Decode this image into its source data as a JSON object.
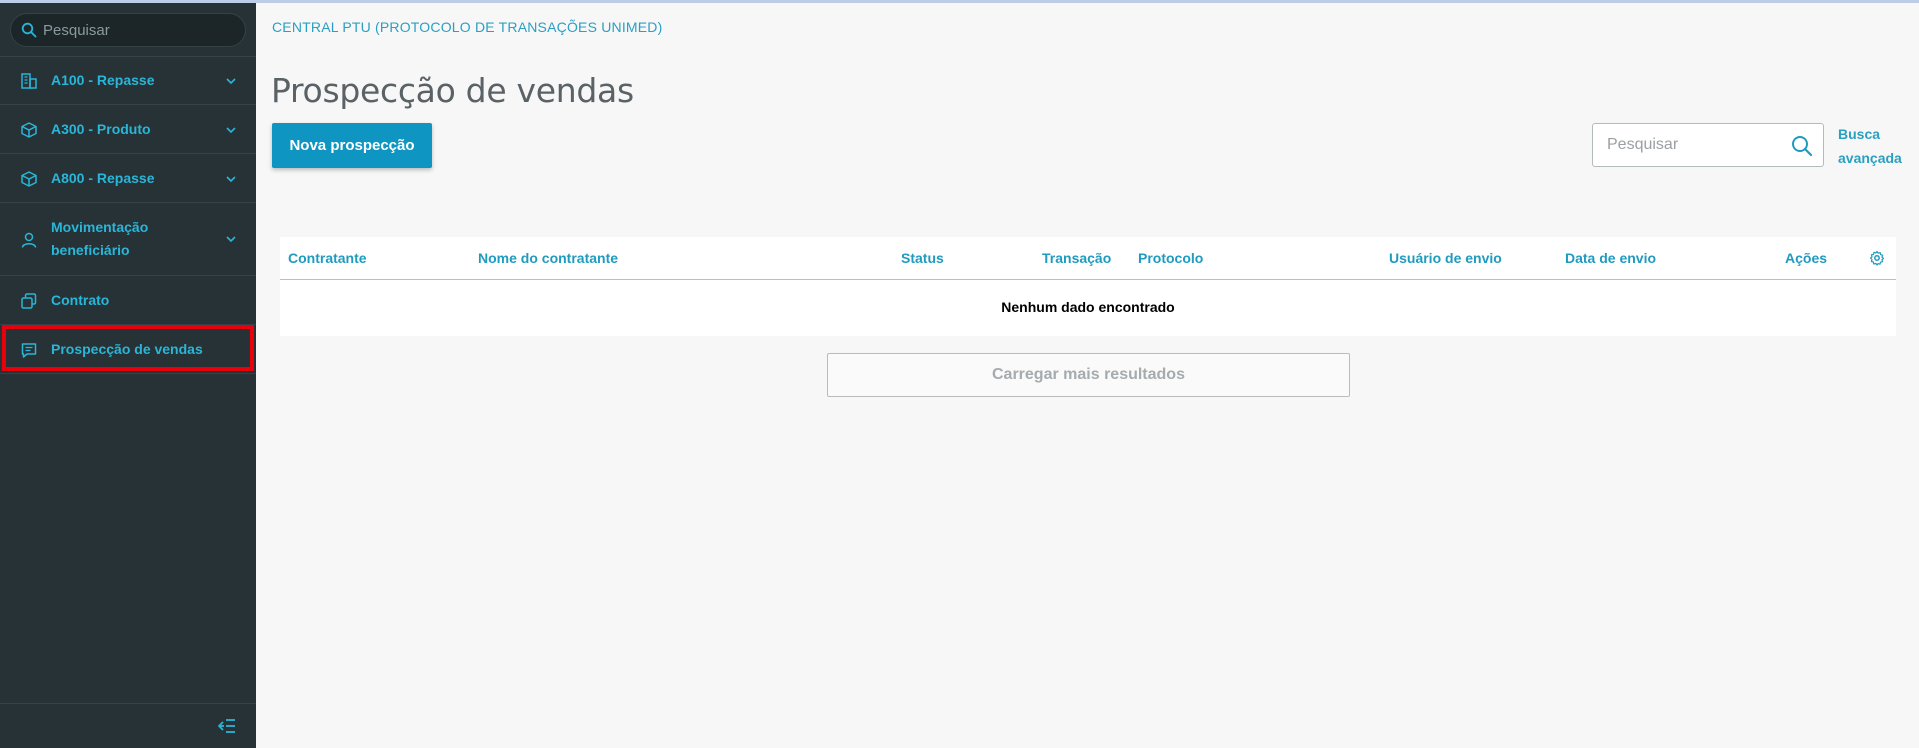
{
  "sidebar": {
    "search_placeholder": "Pesquisar",
    "items": [
      {
        "label": "A100 - Repasse",
        "icon": "building-icon",
        "expandable": true
      },
      {
        "label": "A300 - Produto",
        "icon": "cube-icon",
        "expandable": true
      },
      {
        "label": "A800 - Repasse",
        "icon": "cube-icon",
        "expandable": true
      },
      {
        "label": "Movimentação beneficiário",
        "icon": "user-icon",
        "expandable": true
      },
      {
        "label": "Contrato",
        "icon": "copy-icon",
        "expandable": false
      },
      {
        "label": "Prospecção de vendas",
        "icon": "message-icon",
        "expandable": false,
        "active": true
      }
    ],
    "collapse_icon": "collapse-menu-icon"
  },
  "header": {
    "breadcrumb": "CENTRAL PTU (PROTOCOLO DE TRANSAÇÕES UNIMED)",
    "title": "Prospecção de vendas"
  },
  "toolbar": {
    "new_button_label": "Nova prospecção",
    "search_placeholder": "Pesquisar",
    "advanced_search_label": "Busca avançada"
  },
  "table": {
    "columns": [
      "Contratante",
      "Nome do contratante",
      "Status",
      "Transação",
      "Protocolo",
      "Usuário de envio",
      "Data de envio",
      "Ações"
    ],
    "rows": [],
    "empty_message": "Nenhum dado encontrado",
    "settings_icon": "gear-icon"
  },
  "load_more_label": "Carregar mais resultados",
  "colors": {
    "sidebar_bg": "#263236",
    "accent": "#29b6d8",
    "primary_button": "#0f95c2",
    "highlight_border": "#e8000b",
    "page_bg": "#f7f7f7"
  }
}
